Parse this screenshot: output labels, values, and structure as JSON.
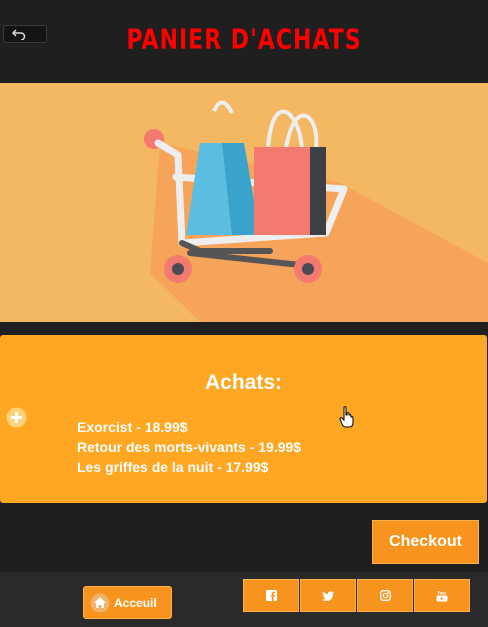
{
  "header": {
    "title": "PANIER D'ACHATS",
    "back_icon": "undo-arrow-icon"
  },
  "hero": {
    "illustration": "shopping-cart-with-bags",
    "colors": {
      "background": "#f4b862",
      "shadow": "#f6a45a",
      "bag_blue": "#5bbde0",
      "bag_red": "#f27a6f",
      "wheel": "#f27a6f"
    }
  },
  "purchases": {
    "title": "Achats:",
    "add_icon": "plus-circle-icon",
    "items": [
      "Exorcist - 18.99$",
      "Retour des morts-vivants - 19.99$",
      "Les griffes de la nuit - 17.99$"
    ]
  },
  "checkout": {
    "label": "Checkout"
  },
  "footer": {
    "home_label": "Acceuil",
    "home_icon": "home-icon",
    "social": [
      "facebook-icon",
      "twitter-icon",
      "instagram-icon",
      "youtube-icon"
    ]
  },
  "colors": {
    "accent": "#f7941d",
    "panel": "#ffa722",
    "background": "#1f1f1f",
    "title": "#ff0000"
  }
}
